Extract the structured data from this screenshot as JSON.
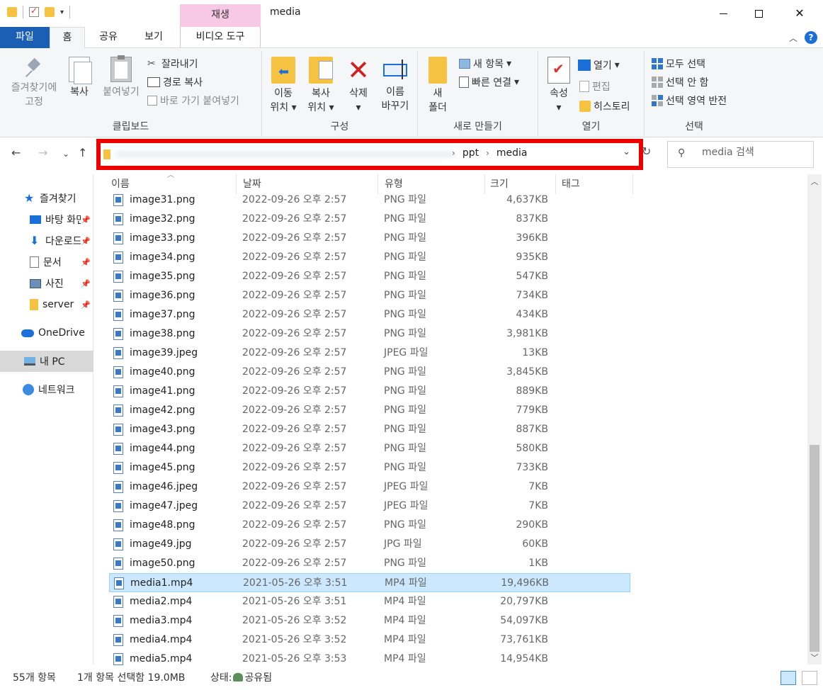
{
  "window": {
    "title": "media",
    "context_tab": "재생",
    "controls": {
      "close": "✕"
    }
  },
  "tabs": [
    {
      "label": "파일"
    },
    {
      "label": "홈"
    },
    {
      "label": "공유"
    },
    {
      "label": "보기"
    },
    {
      "label": "비디오 도구"
    }
  ],
  "ribbon": {
    "clipboard": {
      "pin_label_1": "즐겨찾기에",
      "pin_label_2": "고정",
      "copy": "복사",
      "paste": "붙여넣기",
      "cut": "잘라내기",
      "copy_path": "경로 복사",
      "paste_shortcut": "바로 가기 붙여넣기",
      "group": "클립보드"
    },
    "organize": {
      "move_1": "이동",
      "move_2": "위치",
      "copyto_1": "복사",
      "copyto_2": "위치",
      "delete": "삭제",
      "rename_1": "이름",
      "rename_2": "바꾸기",
      "group": "구성"
    },
    "new": {
      "new_folder_1": "새",
      "new_folder_2": "폴더",
      "new_item": "새 항목",
      "easy_access": "빠른 연결",
      "group": "새로 만들기"
    },
    "open": {
      "properties": "속성",
      "open": "열기",
      "edit": "편집",
      "history": "히스토리",
      "group": "열기"
    },
    "select": {
      "select_all": "모두 선택",
      "select_none": "선택 안 함",
      "invert": "선택 영역 반전",
      "group": "선택"
    }
  },
  "address": {
    "crumbs": [
      "ppt",
      "media"
    ],
    "search_placeholder": "media 검색"
  },
  "sidebar": {
    "items": [
      {
        "label": "즐겨찾기",
        "icon": "star-icon"
      },
      {
        "label": "바탕 화면",
        "icon": "desktop-icon"
      },
      {
        "label": "다운로드",
        "icon": "download-icon"
      },
      {
        "label": "문서",
        "icon": "document-icon"
      },
      {
        "label": "사진",
        "icon": "picture-icon"
      },
      {
        "label": "server",
        "icon": "folder-icon"
      },
      {
        "label": "OneDrive",
        "icon": "cloud-icon"
      },
      {
        "label": "내 PC",
        "icon": "pc-icon"
      },
      {
        "label": "네트워크",
        "icon": "network-icon"
      }
    ]
  },
  "columns": {
    "name": "이름",
    "date": "날짜",
    "type": "유형",
    "size": "크기",
    "tags": "태그"
  },
  "files": [
    {
      "name": "image31.png",
      "date": "2022-09-26 오후 2:57",
      "type": "PNG 파일",
      "size": "4,637KB"
    },
    {
      "name": "image32.png",
      "date": "2022-09-26 오후 2:57",
      "type": "PNG 파일",
      "size": "837KB"
    },
    {
      "name": "image33.png",
      "date": "2022-09-26 오후 2:57",
      "type": "PNG 파일",
      "size": "396KB"
    },
    {
      "name": "image34.png",
      "date": "2022-09-26 오후 2:57",
      "type": "PNG 파일",
      "size": "935KB"
    },
    {
      "name": "image35.png",
      "date": "2022-09-26 오후 2:57",
      "type": "PNG 파일",
      "size": "547KB"
    },
    {
      "name": "image36.png",
      "date": "2022-09-26 오후 2:57",
      "type": "PNG 파일",
      "size": "734KB"
    },
    {
      "name": "image37.png",
      "date": "2022-09-26 오후 2:57",
      "type": "PNG 파일",
      "size": "434KB"
    },
    {
      "name": "image38.png",
      "date": "2022-09-26 오후 2:57",
      "type": "PNG 파일",
      "size": "3,981KB"
    },
    {
      "name": "image39.jpeg",
      "date": "2022-09-26 오후 2:57",
      "type": "JPEG 파일",
      "size": "13KB"
    },
    {
      "name": "image40.png",
      "date": "2022-09-26 오후 2:57",
      "type": "PNG 파일",
      "size": "3,845KB"
    },
    {
      "name": "image41.png",
      "date": "2022-09-26 오후 2:57",
      "type": "PNG 파일",
      "size": "889KB"
    },
    {
      "name": "image42.png",
      "date": "2022-09-26 오후 2:57",
      "type": "PNG 파일",
      "size": "779KB"
    },
    {
      "name": "image43.png",
      "date": "2022-09-26 오후 2:57",
      "type": "PNG 파일",
      "size": "887KB"
    },
    {
      "name": "image44.png",
      "date": "2022-09-26 오후 2:57",
      "type": "PNG 파일",
      "size": "580KB"
    },
    {
      "name": "image45.png",
      "date": "2022-09-26 오후 2:57",
      "type": "PNG 파일",
      "size": "733KB"
    },
    {
      "name": "image46.jpeg",
      "date": "2022-09-26 오후 2:57",
      "type": "JPEG 파일",
      "size": "7KB"
    },
    {
      "name": "image47.jpeg",
      "date": "2022-09-26 오후 2:57",
      "type": "JPEG 파일",
      "size": "7KB"
    },
    {
      "name": "image48.png",
      "date": "2022-09-26 오후 2:57",
      "type": "PNG 파일",
      "size": "290KB"
    },
    {
      "name": "image49.jpg",
      "date": "2022-09-26 오후 2:57",
      "type": "JPG 파일",
      "size": "60KB"
    },
    {
      "name": "image50.png",
      "date": "2022-09-26 오후 2:57",
      "type": "PNG 파일",
      "size": "1KB"
    },
    {
      "name": "media1.mp4",
      "date": "2021-05-26 오후 3:51",
      "type": "MP4 파일",
      "size": "19,496KB"
    },
    {
      "name": "media2.mp4",
      "date": "2021-05-26 오후 3:51",
      "type": "MP4 파일",
      "size": "20,797KB"
    },
    {
      "name": "media3.mp4",
      "date": "2021-05-26 오후 3:52",
      "type": "MP4 파일",
      "size": "54,097KB"
    },
    {
      "name": "media4.mp4",
      "date": "2021-05-26 오후 3:52",
      "type": "MP4 파일",
      "size": "73,761KB"
    },
    {
      "name": "media5.mp4",
      "date": "2021-05-26 오후 3:53",
      "type": "MP4 파일",
      "size": "14,954KB"
    }
  ],
  "status": {
    "count": "55개 항목",
    "selection": "1개 항목 선택함 19.0MB",
    "state_label": "상태:",
    "state_value": "공유됨"
  },
  "colors": {
    "accent": "#1a5fb4",
    "highlight": "#ee0000",
    "selection": "#cce8ff"
  }
}
